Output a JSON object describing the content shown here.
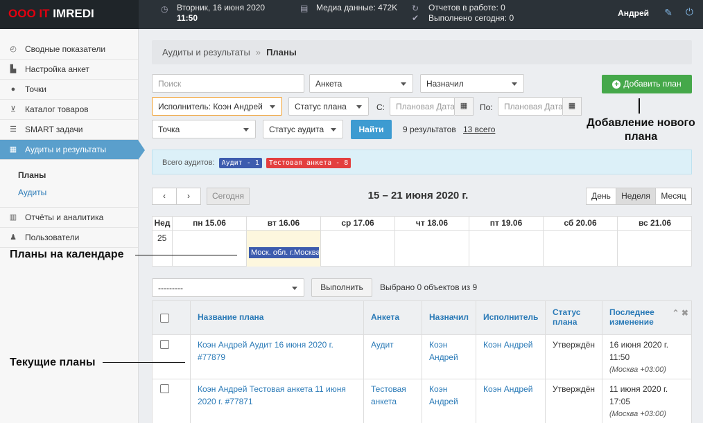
{
  "logo": {
    "part1": "ООО IT",
    "part2": "IMREDI"
  },
  "topbar": {
    "date_text": "Вторник, 16 июня 2020",
    "time_text": "11:50",
    "media_text": "Медиа данные: 472K",
    "reports_working": "Отчетов в работе: 0",
    "done_today": "Выполнено сегодня: 0",
    "user_name": "Андрей",
    "icons": {
      "clock": "clock-icon",
      "media": "drive-icon",
      "refresh": "refresh-icon",
      "check": "check-icon",
      "wrench": "wrench-icon",
      "power": "power-icon"
    }
  },
  "sidebar": {
    "items": [
      {
        "label": "Сводные показатели",
        "icon": "dashboard-icon"
      },
      {
        "label": "Настройка анкет",
        "icon": "document-icon"
      },
      {
        "label": "Точки",
        "icon": "globe-icon"
      },
      {
        "label": "Каталог товаров",
        "icon": "cart-icon"
      },
      {
        "label": "SMART задачи",
        "icon": "tasks-icon"
      },
      {
        "label": "Аудиты и результаты",
        "icon": "calendar-icon"
      },
      {
        "label": "Отчёты и аналитика",
        "icon": "chart-icon"
      },
      {
        "label": "Пользователи",
        "icon": "user-icon"
      }
    ],
    "sub_items": [
      {
        "label": "Планы"
      },
      {
        "label": "Аудиты"
      }
    ]
  },
  "breadcrumb": {
    "parent": "Аудиты и результаты",
    "separator": "»",
    "current": "Планы"
  },
  "filters": {
    "search_placeholder": "Поиск",
    "survey": "Анкета",
    "assigned_by": "Назначил",
    "executor": "Исполнитель: Коэн Андрей",
    "plan_status": "Статус плана",
    "from_label": "С:",
    "from_placeholder": "Плановая Дата",
    "to_label": "По:",
    "to_placeholder": "Плановая Дата",
    "point": "Точка",
    "audit_status": "Статус аудита",
    "find_button": "Найти",
    "results_count": "9 результатов",
    "total_link": "13 всего",
    "add_plan_button": "Добавить план"
  },
  "summary": {
    "label": "Всего аудитов:",
    "badge_audit": "Аудит - 1",
    "badge_test": "Тестовая анкета - 8"
  },
  "calendar_nav": {
    "prev": "‹",
    "next": "›",
    "today": "Сегодня",
    "week_title": "15 – 21 июня 2020 г.",
    "view_day": "День",
    "view_week": "Неделя",
    "view_month": "Месяц"
  },
  "calendar": {
    "week_header": "Нед",
    "week_number": "25",
    "days": [
      "пн 15.06",
      "вт 16.06",
      "ср 17.06",
      "чт 18.06",
      "пт 19.06",
      "сб 20.06",
      "вс 21.06"
    ],
    "event_text": "Моск. обл. г.Москва"
  },
  "bulk": {
    "select_value": "---------",
    "execute_button": "Выполнить",
    "selected_text": "Выбрано 0 объектов из 9"
  },
  "table": {
    "headers": {
      "name": "Название плана",
      "survey": "Анкета",
      "assigned": "Назначил",
      "executor": "Исполнитель",
      "status_1": "Статус",
      "status_2": "плана",
      "changed_1": "Последнее",
      "changed_2": "изменение"
    },
    "rows": [
      {
        "name_1": "Коэн Андрей Аудит 16 июня 2020 г.",
        "name_2": "#77879",
        "survey_1": "Аудит",
        "survey_2": "",
        "assigned_1": "Коэн",
        "assigned_2": "Андрей",
        "executor": "Коэн Андрей",
        "status": "Утверждён",
        "date": "16 июня 2020 г.",
        "time": "11:50",
        "tz": "(Москва +03:00)"
      },
      {
        "name_1": "Коэн Андрей Тестовая анкета 11 июня",
        "name_2": "2020 г. #77871",
        "survey_1": "Тестовая",
        "survey_2": "анкета",
        "assigned_1": "Коэн",
        "assigned_2": "Андрей",
        "executor": "Коэн Андрей",
        "status": "Утверждён",
        "date": "11 июня 2020 г.",
        "time": "17:05",
        "tz": "(Москва +03:00)"
      }
    ]
  },
  "annotations": {
    "add_plan_1": "Добавление нового",
    "add_plan_2": "плана",
    "calendar_plans": "Планы на календаре",
    "current_plans": "Текущие планы"
  }
}
